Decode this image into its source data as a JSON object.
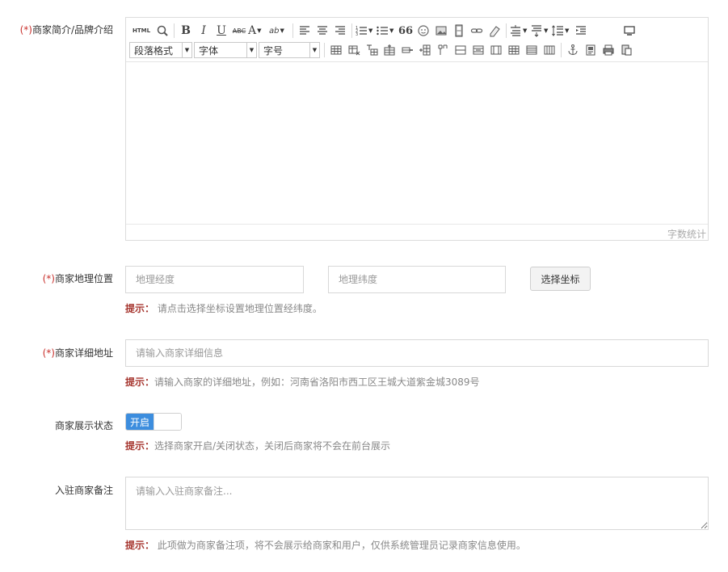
{
  "brand_intro": {
    "required_mark": "(*)",
    "label": "商家简介/品牌介绍",
    "toolbar": {
      "html_label": "HTML",
      "bold": "B",
      "italic": "I",
      "underline": "U",
      "strike": "ABC",
      "font_color": "A",
      "highlight": "ab",
      "paragraph_format": "段落格式",
      "font_family": "字体",
      "font_size": "字号",
      "quote": "66"
    },
    "word_count_label": "字数统计"
  },
  "location": {
    "required_mark": "(*)",
    "label": "商家地理位置",
    "longitude_placeholder": "地理经度",
    "latitude_placeholder": "地理纬度",
    "choose_button": "选择坐标",
    "hint_prefix": "提示：",
    "hint_text": " 请点击选择坐标设置地理位置经纬度。"
  },
  "address": {
    "required_mark": "(*)",
    "label": "商家详细地址",
    "placeholder": "请输入商家详细信息",
    "hint_prefix": "提示：",
    "hint_text": "请输入商家的详细地址，例如：河南省洛阳市西工区王城大道紫金城3089号"
  },
  "display_status": {
    "label": "商家展示状态",
    "toggle_on_label": "开启",
    "hint_prefix": "提示：",
    "hint_text": "选择商家开启/关闭状态，关闭后商家将不会在前台展示"
  },
  "remark": {
    "label": "入驻商家备注",
    "placeholder": "请输入入驻商家备注...",
    "hint_prefix": "提示：",
    "hint_text": " 此项做为商家备注项，将不会展示给商家和用户，仅供系统管理员记录商家信息使用。"
  },
  "colors": {
    "required": "#c9302c",
    "hint_prefix": "#a6362f",
    "toggle_on": "#3c8dde"
  }
}
